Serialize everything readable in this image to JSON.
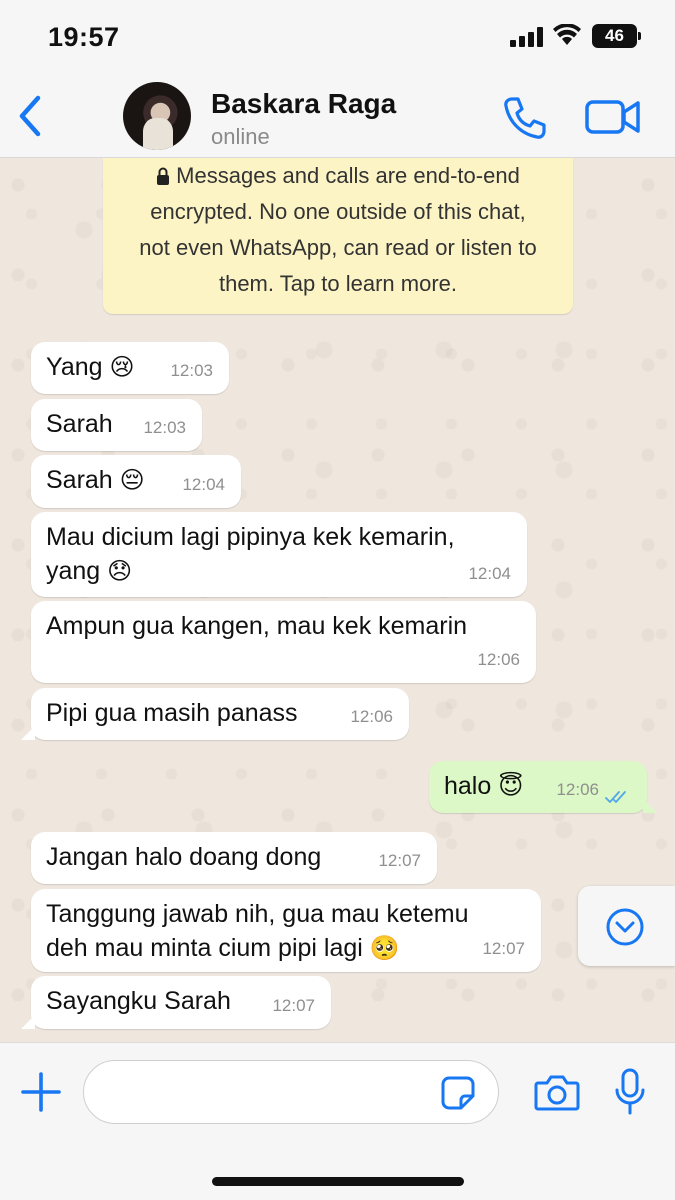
{
  "status_bar": {
    "time": "19:57",
    "battery": "46"
  },
  "header": {
    "contact_name": "Baskara Raga",
    "contact_status": "online",
    "accent_color": "#1877f2",
    "icons": [
      "back-chevron-icon",
      "phone-icon",
      "video-camera-icon"
    ]
  },
  "encryption_notice": {
    "text": "Messages and calls are end-to-end\nencrypted. No one outside of this chat,\nnot even WhatsApp, can read or listen to\nthem. Tap to learn more."
  },
  "messages": [
    {
      "direction": "in",
      "text": "Yang",
      "emoji": "😢",
      "time": "12:03"
    },
    {
      "direction": "in",
      "text": "Sarah",
      "emoji": "",
      "time": "12:03"
    },
    {
      "direction": "in",
      "text": "Sarah",
      "emoji": "😔",
      "time": "12:04"
    },
    {
      "direction": "in",
      "text": "Mau dicium lagi pipinya kek kemarin,\nyang",
      "emoji": "😞",
      "time": "12:04"
    },
    {
      "direction": "in",
      "text": "Ampun gua kangen, mau kek kemarin",
      "emoji": "",
      "time": "12:06"
    },
    {
      "direction": "in",
      "text": "Pipi gua masih panass",
      "emoji": "",
      "time": "12:06"
    },
    {
      "direction": "out",
      "text": "halo",
      "emoji": "😇",
      "time": "12:06",
      "status": "read"
    },
    {
      "direction": "in",
      "text": "Jangan halo doang dong",
      "emoji": "",
      "time": "12:07"
    },
    {
      "direction": "in",
      "text": "Tanggung jawab nih, gua mau ketemu\ndeh mau minta cium pipi lagi",
      "emoji": "🥺",
      "time": "12:07"
    },
    {
      "direction": "in",
      "text": "Sayangku Sarah",
      "emoji": "",
      "time": "12:07"
    }
  ],
  "input_bar": {
    "placeholder": "",
    "value": "",
    "icons": [
      "plus-icon",
      "sticker-icon",
      "camera-icon",
      "microphone-icon"
    ]
  }
}
